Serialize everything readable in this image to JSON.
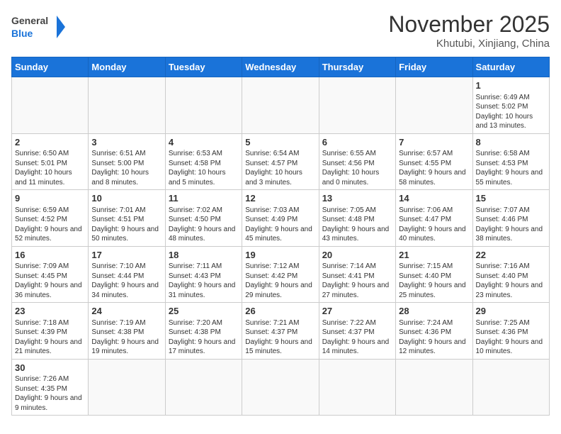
{
  "header": {
    "logo_general": "General",
    "logo_blue": "Blue",
    "month": "November 2025",
    "location": "Khutubi, Xinjiang, China"
  },
  "weekdays": [
    "Sunday",
    "Monday",
    "Tuesday",
    "Wednesday",
    "Thursday",
    "Friday",
    "Saturday"
  ],
  "weeks": [
    [
      {
        "day": "",
        "info": ""
      },
      {
        "day": "",
        "info": ""
      },
      {
        "day": "",
        "info": ""
      },
      {
        "day": "",
        "info": ""
      },
      {
        "day": "",
        "info": ""
      },
      {
        "day": "",
        "info": ""
      },
      {
        "day": "1",
        "info": "Sunrise: 6:49 AM\nSunset: 5:02 PM\nDaylight: 10 hours and 13 minutes."
      }
    ],
    [
      {
        "day": "2",
        "info": "Sunrise: 6:50 AM\nSunset: 5:01 PM\nDaylight: 10 hours and 11 minutes."
      },
      {
        "day": "3",
        "info": "Sunrise: 6:51 AM\nSunset: 5:00 PM\nDaylight: 10 hours and 8 minutes."
      },
      {
        "day": "4",
        "info": "Sunrise: 6:53 AM\nSunset: 4:58 PM\nDaylight: 10 hours and 5 minutes."
      },
      {
        "day": "5",
        "info": "Sunrise: 6:54 AM\nSunset: 4:57 PM\nDaylight: 10 hours and 3 minutes."
      },
      {
        "day": "6",
        "info": "Sunrise: 6:55 AM\nSunset: 4:56 PM\nDaylight: 10 hours and 0 minutes."
      },
      {
        "day": "7",
        "info": "Sunrise: 6:57 AM\nSunset: 4:55 PM\nDaylight: 9 hours and 58 minutes."
      },
      {
        "day": "8",
        "info": "Sunrise: 6:58 AM\nSunset: 4:53 PM\nDaylight: 9 hours and 55 minutes."
      }
    ],
    [
      {
        "day": "9",
        "info": "Sunrise: 6:59 AM\nSunset: 4:52 PM\nDaylight: 9 hours and 52 minutes."
      },
      {
        "day": "10",
        "info": "Sunrise: 7:01 AM\nSunset: 4:51 PM\nDaylight: 9 hours and 50 minutes."
      },
      {
        "day": "11",
        "info": "Sunrise: 7:02 AM\nSunset: 4:50 PM\nDaylight: 9 hours and 48 minutes."
      },
      {
        "day": "12",
        "info": "Sunrise: 7:03 AM\nSunset: 4:49 PM\nDaylight: 9 hours and 45 minutes."
      },
      {
        "day": "13",
        "info": "Sunrise: 7:05 AM\nSunset: 4:48 PM\nDaylight: 9 hours and 43 minutes."
      },
      {
        "day": "14",
        "info": "Sunrise: 7:06 AM\nSunset: 4:47 PM\nDaylight: 9 hours and 40 minutes."
      },
      {
        "day": "15",
        "info": "Sunrise: 7:07 AM\nSunset: 4:46 PM\nDaylight: 9 hours and 38 minutes."
      }
    ],
    [
      {
        "day": "16",
        "info": "Sunrise: 7:09 AM\nSunset: 4:45 PM\nDaylight: 9 hours and 36 minutes."
      },
      {
        "day": "17",
        "info": "Sunrise: 7:10 AM\nSunset: 4:44 PM\nDaylight: 9 hours and 34 minutes."
      },
      {
        "day": "18",
        "info": "Sunrise: 7:11 AM\nSunset: 4:43 PM\nDaylight: 9 hours and 31 minutes."
      },
      {
        "day": "19",
        "info": "Sunrise: 7:12 AM\nSunset: 4:42 PM\nDaylight: 9 hours and 29 minutes."
      },
      {
        "day": "20",
        "info": "Sunrise: 7:14 AM\nSunset: 4:41 PM\nDaylight: 9 hours and 27 minutes."
      },
      {
        "day": "21",
        "info": "Sunrise: 7:15 AM\nSunset: 4:40 PM\nDaylight: 9 hours and 25 minutes."
      },
      {
        "day": "22",
        "info": "Sunrise: 7:16 AM\nSunset: 4:40 PM\nDaylight: 9 hours and 23 minutes."
      }
    ],
    [
      {
        "day": "23",
        "info": "Sunrise: 7:18 AM\nSunset: 4:39 PM\nDaylight: 9 hours and 21 minutes."
      },
      {
        "day": "24",
        "info": "Sunrise: 7:19 AM\nSunset: 4:38 PM\nDaylight: 9 hours and 19 minutes."
      },
      {
        "day": "25",
        "info": "Sunrise: 7:20 AM\nSunset: 4:38 PM\nDaylight: 9 hours and 17 minutes."
      },
      {
        "day": "26",
        "info": "Sunrise: 7:21 AM\nSunset: 4:37 PM\nDaylight: 9 hours and 15 minutes."
      },
      {
        "day": "27",
        "info": "Sunrise: 7:22 AM\nSunset: 4:37 PM\nDaylight: 9 hours and 14 minutes."
      },
      {
        "day": "28",
        "info": "Sunrise: 7:24 AM\nSunset: 4:36 PM\nDaylight: 9 hours and 12 minutes."
      },
      {
        "day": "29",
        "info": "Sunrise: 7:25 AM\nSunset: 4:36 PM\nDaylight: 9 hours and 10 minutes."
      }
    ],
    [
      {
        "day": "30",
        "info": "Sunrise: 7:26 AM\nSunset: 4:35 PM\nDaylight: 9 hours and 9 minutes."
      },
      {
        "day": "",
        "info": ""
      },
      {
        "day": "",
        "info": ""
      },
      {
        "day": "",
        "info": ""
      },
      {
        "day": "",
        "info": ""
      },
      {
        "day": "",
        "info": ""
      },
      {
        "day": "",
        "info": ""
      }
    ]
  ]
}
